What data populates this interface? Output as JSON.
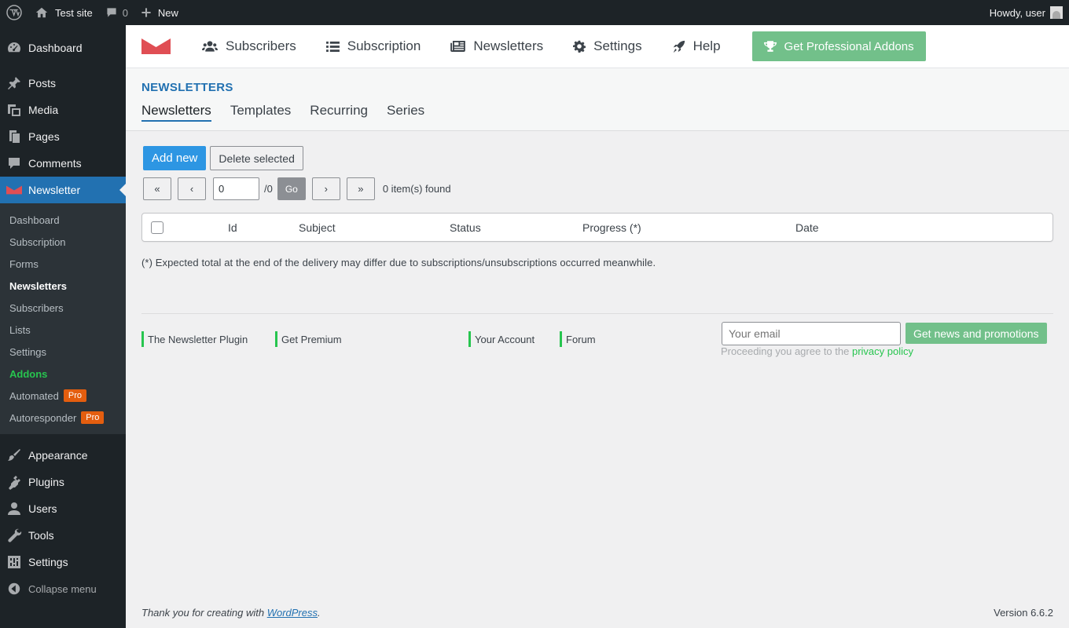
{
  "admin_bar": {
    "site_name": "Test site",
    "comments_count": "0",
    "new_label": "New",
    "greeting": "Howdy, user"
  },
  "sidebar": {
    "top_items": [
      {
        "label": "Dashboard",
        "icon": "dashboard-icon"
      },
      {
        "label": "Posts",
        "icon": "pin-icon"
      },
      {
        "label": "Media",
        "icon": "media-icon"
      },
      {
        "label": "Pages",
        "icon": "pages-icon"
      },
      {
        "label": "Comments",
        "icon": "comment-icon"
      }
    ],
    "active_item": {
      "label": "Newsletter",
      "icon": "newsletter-icon"
    },
    "submenu": [
      {
        "label": "Dashboard"
      },
      {
        "label": "Subscription"
      },
      {
        "label": "Forms"
      },
      {
        "label": "Newsletters",
        "current": true
      },
      {
        "label": "Subscribers"
      },
      {
        "label": "Lists"
      },
      {
        "label": "Settings"
      },
      {
        "label": "Addons"
      },
      {
        "label": "Automated",
        "badge": "Pro"
      },
      {
        "label": "Autoresponder",
        "badge": "Pro"
      }
    ],
    "bottom_items": [
      {
        "label": "Appearance",
        "icon": "brush-icon"
      },
      {
        "label": "Plugins",
        "icon": "plugin-icon"
      },
      {
        "label": "Users",
        "icon": "user-icon"
      },
      {
        "label": "Tools",
        "icon": "wrench-icon"
      },
      {
        "label": "Settings",
        "icon": "settings-icon"
      }
    ],
    "collapse_label": "Collapse menu"
  },
  "plugin_nav": {
    "items": [
      {
        "label": "Subscribers",
        "icon": "users-icon"
      },
      {
        "label": "Subscription",
        "icon": "list-icon"
      },
      {
        "label": "Newsletters",
        "icon": "newspaper-icon"
      },
      {
        "label": "Settings",
        "icon": "cog-icon"
      },
      {
        "label": "Help",
        "icon": "rocket-icon"
      }
    ],
    "pro_button": "Get Professional Addons"
  },
  "heading": {
    "title": "NEWSLETTERS",
    "tabs": [
      "Newsletters",
      "Templates",
      "Recurring",
      "Series"
    ]
  },
  "actions": {
    "add_new": "Add new",
    "delete_selected": "Delete selected"
  },
  "pager": {
    "first": "«",
    "prev": "‹",
    "page_value": "0",
    "total": "/0",
    "go": "Go",
    "next": "›",
    "last": "»",
    "items_found": "0 item(s) found"
  },
  "table": {
    "columns": [
      "Id",
      "Subject",
      "Status",
      "Progress (*)",
      "Date"
    ]
  },
  "note": "(*) Expected total at the end of the delivery may differ due to subscriptions/unsubscriptions occurred meanwhile.",
  "footer": {
    "links": [
      "The Newsletter Plugin",
      "Get Premium",
      "Your Account",
      "Forum"
    ],
    "email_placeholder": "Your email",
    "news_button": "Get news and promotions",
    "privacy_prefix": "Proceeding you agree to the",
    "privacy_link": "privacy policy"
  },
  "wp_footer": {
    "thanks_prefix": "Thank you for creating with",
    "thanks_link": "WordPress",
    "thanks_suffix": ".",
    "version": "Version 6.6.2"
  },
  "colors": {
    "admin_dark": "#1d2327",
    "wp_blue": "#2271b1",
    "tnp_green": "#72c08a",
    "addon_green": "#27c54f",
    "pro_orange": "#e45e0f",
    "tnp_red": "#e04e54"
  }
}
